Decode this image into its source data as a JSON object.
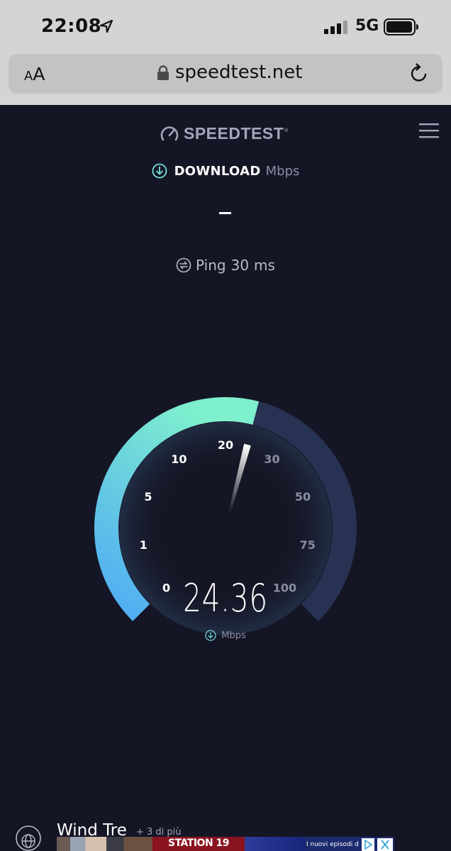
{
  "status_bar": {
    "time": "22:08",
    "network": "5G"
  },
  "browser": {
    "aa_small": "A",
    "aa_big": "A",
    "url": "speedtest.net"
  },
  "header": {
    "logo": "SPEEDTEST",
    "logo_mark": "®"
  },
  "download": {
    "title": "DOWNLOAD",
    "unit": "Mbps",
    "value": "–"
  },
  "ping": {
    "label": "Ping",
    "value": "30",
    "unit": "ms"
  },
  "gauge": {
    "ticks": [
      "0",
      "1",
      "5",
      "10",
      "20",
      "30",
      "50",
      "75",
      "100"
    ],
    "current_speed": "24.36",
    "unit": "Mbps",
    "colors": {
      "fill_start": "#4faaf5",
      "fill_end": "#7ff0cd",
      "track": "#283253"
    }
  },
  "footer": {
    "isp_name": "Wind Tre",
    "isp_more": "+ 3 di più",
    "ad_title": "STATION 19",
    "ad_text": "I nuovi episodi d"
  }
}
